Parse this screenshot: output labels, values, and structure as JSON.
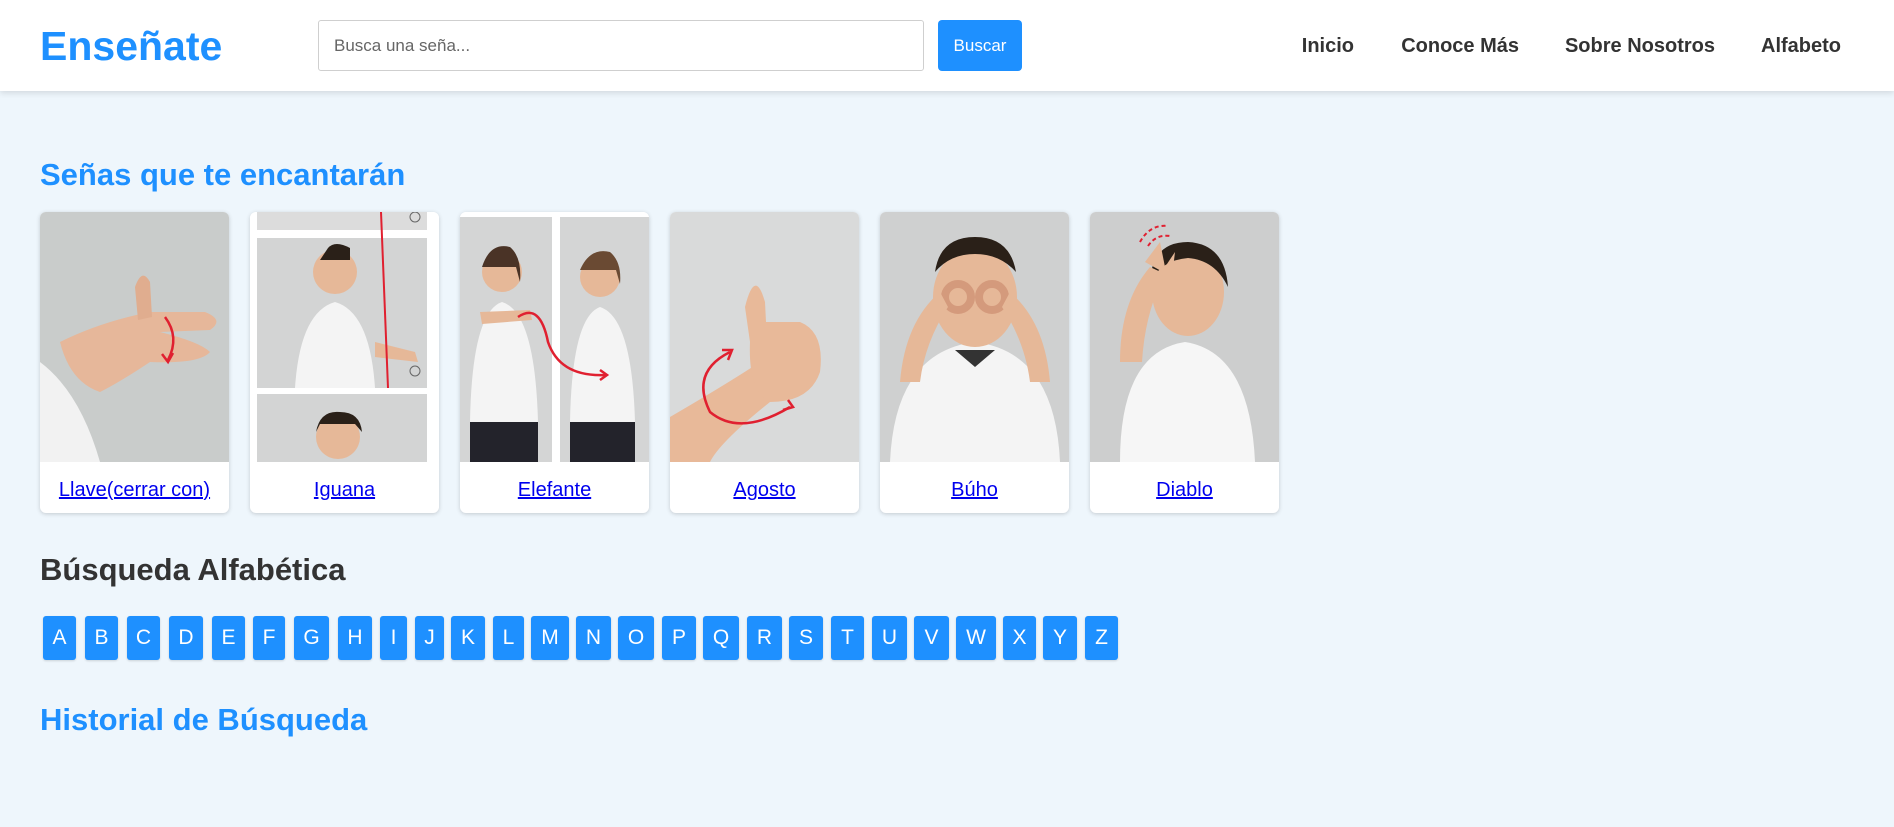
{
  "header": {
    "logo": "Enseñate",
    "search_placeholder": "Busca una seña...",
    "search_button": "Buscar",
    "nav": [
      "Inicio",
      "Conoce Más",
      "Sobre Nosotros",
      "Alfabeto"
    ]
  },
  "featured": {
    "title": "Señas que te encantarán",
    "cards": [
      {
        "label": "Llave(cerrar con)"
      },
      {
        "label": "Iguana"
      },
      {
        "label": "Elefante"
      },
      {
        "label": "Agosto"
      },
      {
        "label": "Búho"
      },
      {
        "label": "Diablo"
      }
    ]
  },
  "alphabet": {
    "title": "Búsqueda Alfabética",
    "letters": [
      "A",
      "B",
      "C",
      "D",
      "E",
      "F",
      "G",
      "H",
      "I",
      "J",
      "K",
      "L",
      "M",
      "N",
      "O",
      "P",
      "Q",
      "R",
      "S",
      "T",
      "U",
      "V",
      "W",
      "X",
      "Y",
      "Z"
    ]
  },
  "history": {
    "title": "Historial de Búsqueda"
  },
  "colors": {
    "accent": "#1e90ff",
    "background": "#eef6fc",
    "link": "#0000ee"
  }
}
